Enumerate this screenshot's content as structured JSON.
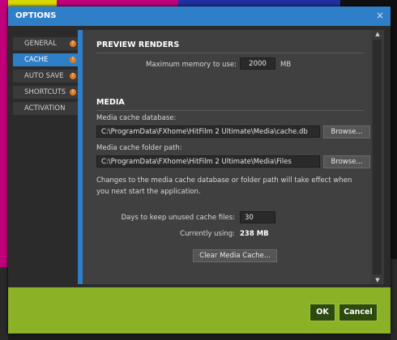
{
  "window": {
    "title": "OPTIONS",
    "close_glyph": "×"
  },
  "sidebar": {
    "items": [
      {
        "label": "GENERAL",
        "icon": "info-icon",
        "active": false
      },
      {
        "label": "CACHE",
        "icon": "info-icon",
        "active": true
      },
      {
        "label": "AUTO SAVE",
        "icon": "info-icon",
        "active": false
      },
      {
        "label": "SHORTCUTS",
        "icon": "info-icon",
        "active": false
      },
      {
        "label": "ACTIVATION",
        "icon": "",
        "active": false
      }
    ],
    "badge_glyph": "?"
  },
  "preview": {
    "title": "PREVIEW RENDERS",
    "max_mem_label": "Maximum memory to use:",
    "max_mem_value": "2000",
    "max_mem_unit": "MB"
  },
  "media": {
    "title": "MEDIA",
    "db_label": "Media cache database:",
    "db_value": "C:\\ProgramData\\FXhome\\HitFilm 2 Ultimate\\Media\\cache.db",
    "db_browse": "Browse...",
    "folder_label": "Media cache folder path:",
    "folder_value": "C:\\ProgramData\\FXhome\\HitFilm 2 Ultimate\\Media\\Files",
    "folder_browse": "Browse...",
    "note": "Changes to the media cache database or folder path will take effect when you next start the application.",
    "days_label": "Days to keep unused cache files:",
    "days_value": "30",
    "using_label": "Currently using:",
    "using_value": "238 MB",
    "clear_button": "Clear Media Cache..."
  },
  "scrollbar": {
    "up_glyph": "▲",
    "down_glyph": "▼"
  },
  "footer": {
    "ok_label": "OK",
    "cancel_label": "Cancel"
  },
  "colors": {
    "accent": "#2f7ec8",
    "footer": "#8bb226",
    "badge": "#e07a1e"
  }
}
